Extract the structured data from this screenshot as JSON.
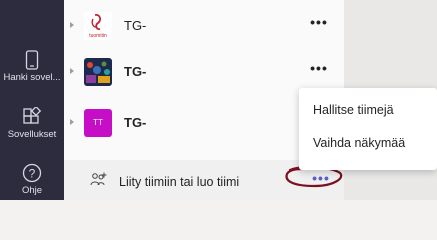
{
  "rail": {
    "items": [
      {
        "label": "Hanki sovel...",
        "icon": "phone-icon"
      },
      {
        "label": "Sovellukset",
        "icon": "apps-icon"
      },
      {
        "label": "Ohje",
        "icon": "help-icon"
      }
    ]
  },
  "teams": [
    {
      "name": "TG-",
      "avatar": "tuomitin-logo",
      "bold": false
    },
    {
      "name": "TG-",
      "avatar": "photo-avatar",
      "bold": true
    },
    {
      "name": "TG-",
      "avatar": "TT",
      "avatar_color": "#c50ec5",
      "bold": true
    }
  ],
  "more_glyph": "•••",
  "join": {
    "label": "Liity tiimiin tai luo tiimi",
    "icon": "add-team-icon"
  },
  "menu": {
    "items": [
      {
        "label": "Hallitse tiimejä"
      },
      {
        "label": "Vaihda näkymää"
      }
    ]
  },
  "logo_text": "tuomitin",
  "colors": {
    "rail_bg": "#2d2c3f",
    "accent": "#5b5fc7",
    "annotation": "#7a1020"
  }
}
